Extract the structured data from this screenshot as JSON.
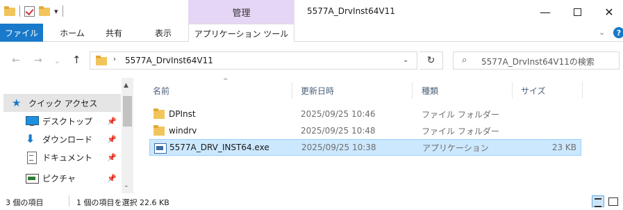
{
  "titlebar": {
    "manage_tab": "管理",
    "title": "5577A_DrvInst64V11",
    "minimize": "—",
    "close": "✕",
    "qat_dropdown": "▾"
  },
  "ribbon": {
    "tabs": {
      "file": "ファイル",
      "home": "ホーム",
      "share": "共有",
      "view": "表示",
      "app_tools": "アプリケーション ツール"
    },
    "collapse": "⌄",
    "help": "?"
  },
  "nav": {
    "back": "←",
    "forward": "→",
    "recent": "⌄",
    "up": "↑"
  },
  "address": {
    "separator": "›",
    "path": "5577A_DrvInst64V11",
    "dropdown": "⌄",
    "refresh": "↻"
  },
  "search": {
    "icon": "⌕",
    "placeholder": "5577A_DrvInst64V11の検索"
  },
  "sidebar": {
    "scroll_up": "▲",
    "scroll_down": "⌄",
    "pin": "📌",
    "items": [
      {
        "label": "クイック アクセス",
        "icon": "star-icon"
      },
      {
        "label": "デスクトップ",
        "icon": "desktop-icon"
      },
      {
        "label": "ダウンロード",
        "icon": "download-icon"
      },
      {
        "label": "ドキュメント",
        "icon": "document-icon"
      },
      {
        "label": "ピクチャ",
        "icon": "pictures-icon"
      }
    ]
  },
  "columns": {
    "name": "名前",
    "date": "更新日時",
    "type": "種類",
    "size": "サイズ",
    "sort_arrow": "^"
  },
  "files": [
    {
      "name": "DPInst",
      "date": "2025/09/25 10:46",
      "type": "ファイル フォルダー",
      "size": "",
      "icon": "folder-icon"
    },
    {
      "name": "windrv",
      "date": "2025/09/25 10:48",
      "type": "ファイル フォルダー",
      "size": "",
      "icon": "folder-icon"
    },
    {
      "name": "5577A_DRV_INST64.exe",
      "date": "2025/09/25 10:38",
      "type": "アプリケーション",
      "size": "23 KB",
      "icon": "exe-icon",
      "selected": true
    }
  ],
  "status": {
    "item_count": "3 個の項目",
    "selection": "1 個の項目を選択 22.6 KB"
  },
  "colors": {
    "accent": "#1979ca",
    "manage_tab": "#e6d6f5",
    "selection": "#cce8ff",
    "folder": "#f2c55c"
  }
}
